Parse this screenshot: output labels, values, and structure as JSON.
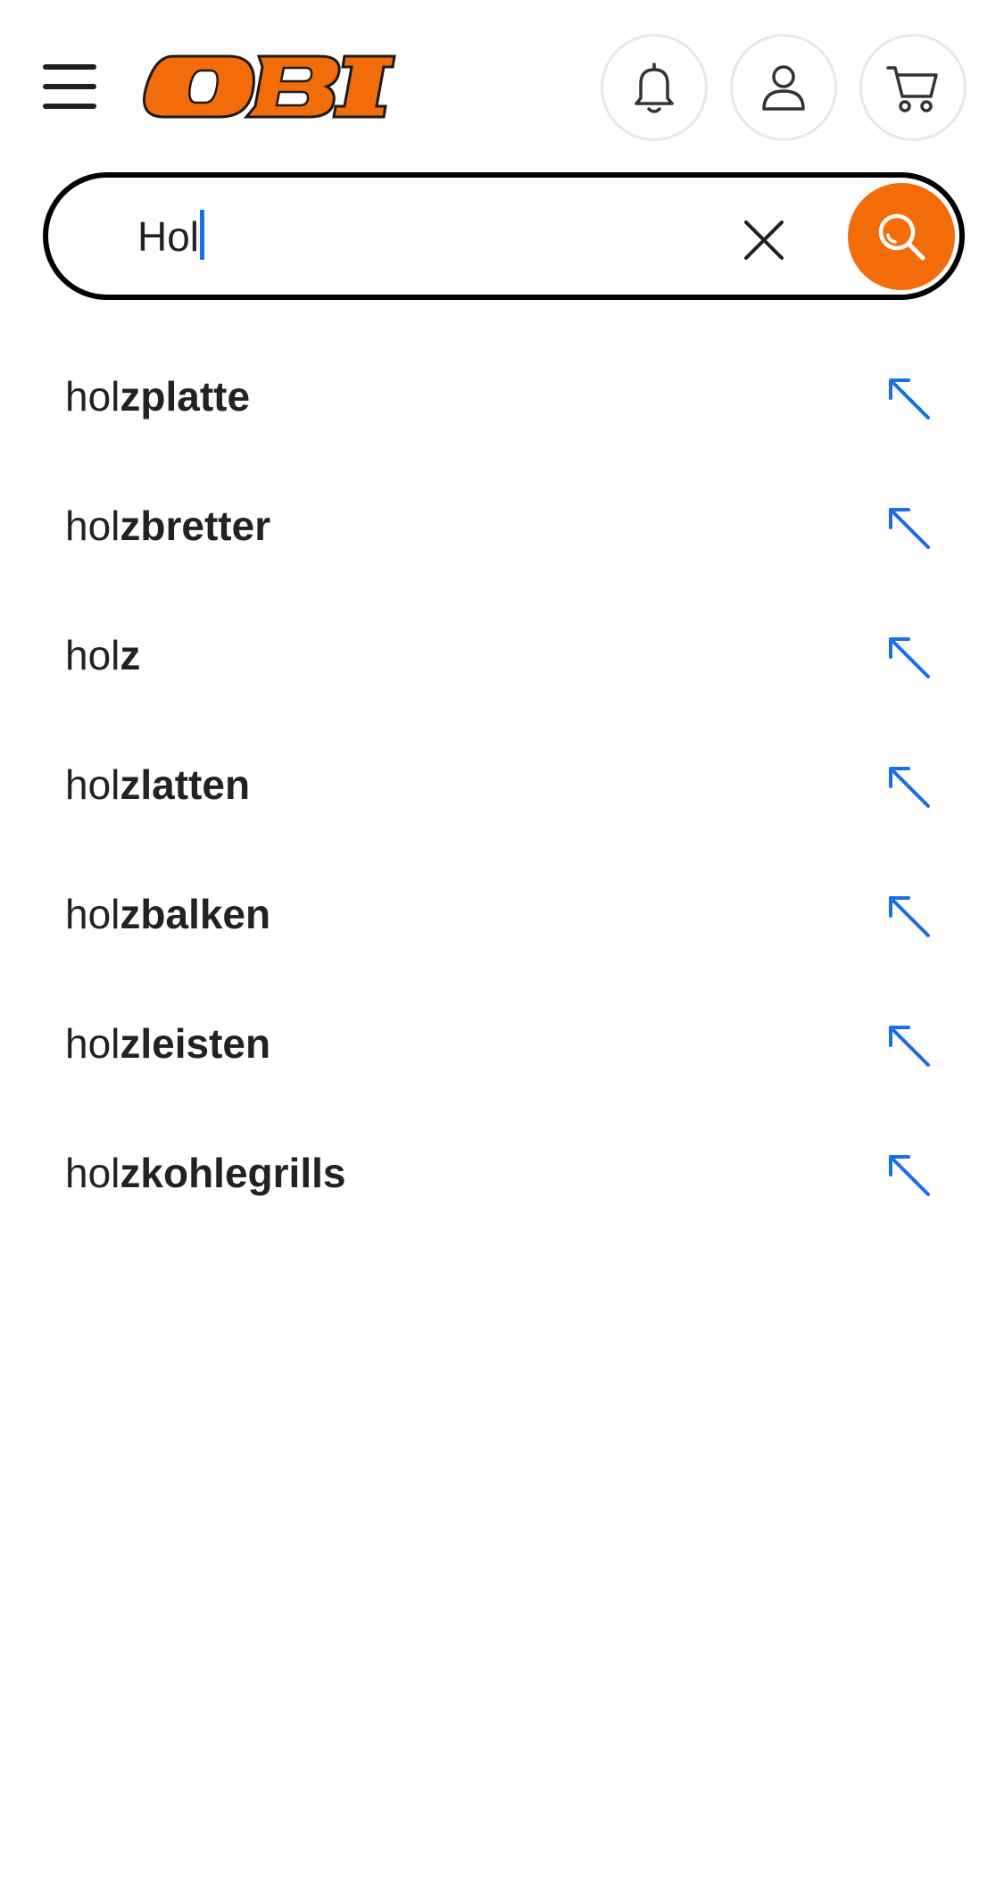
{
  "header": {
    "logo_text": "OBI",
    "icons": {
      "menu": "hamburger-menu-icon",
      "notifications": "bell-icon",
      "account": "user-icon",
      "cart": "shopping-cart-icon"
    }
  },
  "search": {
    "value": "Hol",
    "icons": {
      "clear": "close-icon",
      "submit": "search-icon"
    }
  },
  "suggestions": [
    {
      "typed": "hol",
      "completion": "zplatte"
    },
    {
      "typed": "hol",
      "completion": "zbretter"
    },
    {
      "typed": "hol",
      "completion": "z"
    },
    {
      "typed": "hol",
      "completion": "zlatten"
    },
    {
      "typed": "hol",
      "completion": "zbalken"
    },
    {
      "typed": "hol",
      "completion": "zleisten"
    },
    {
      "typed": "hol",
      "completion": "zkohlegrills"
    }
  ],
  "colors": {
    "brand_orange": "#f36c0a",
    "accent_blue": "#1a6ee8",
    "text": "#222222"
  }
}
